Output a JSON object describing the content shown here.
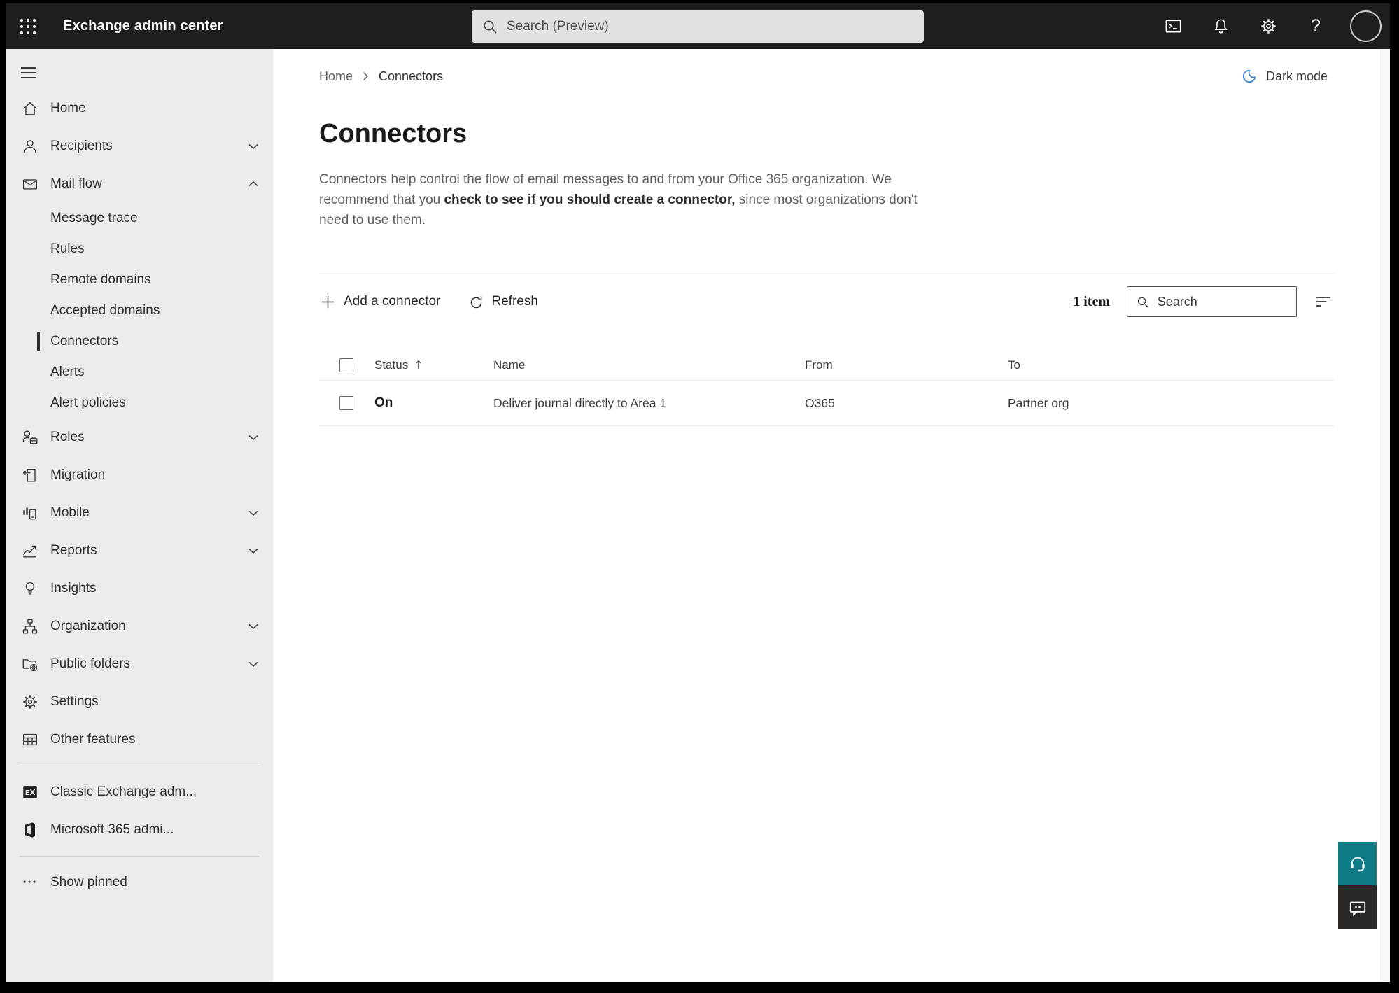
{
  "topbar": {
    "app_title": "Exchange admin center",
    "search_placeholder": "Search (Preview)",
    "icons": [
      "apps-grid-icon",
      "search-icon",
      "terminal-icon",
      "bell-icon",
      "gear-icon",
      "help-icon",
      "avatar"
    ],
    "help_glyph": "?"
  },
  "sidebar": {
    "items": [
      {
        "label": "Home",
        "icon": "home-icon"
      },
      {
        "label": "Recipients",
        "icon": "person-icon",
        "chevron": "down"
      },
      {
        "label": "Mail flow",
        "icon": "mail-icon",
        "chevron": "up",
        "expanded": true
      },
      {
        "label": "Message trace",
        "sub": true
      },
      {
        "label": "Rules",
        "sub": true
      },
      {
        "label": "Remote domains",
        "sub": true
      },
      {
        "label": "Accepted domains",
        "sub": true
      },
      {
        "label": "Connectors",
        "sub": true,
        "selected": true
      },
      {
        "label": "Alerts",
        "sub": true
      },
      {
        "label": "Alert policies",
        "sub": true
      },
      {
        "label": "Roles",
        "icon": "roles-icon",
        "chevron": "down"
      },
      {
        "label": "Migration",
        "icon": "migration-icon"
      },
      {
        "label": "Mobile",
        "icon": "mobile-icon",
        "chevron": "down"
      },
      {
        "label": "Reports",
        "icon": "reports-icon",
        "chevron": "down"
      },
      {
        "label": "Insights",
        "icon": "insights-icon"
      },
      {
        "label": "Organization",
        "icon": "organization-icon",
        "chevron": "down"
      },
      {
        "label": "Public folders",
        "icon": "public-folders-icon",
        "chevron": "down"
      },
      {
        "label": "Settings",
        "icon": "gear-icon"
      },
      {
        "label": "Other features",
        "icon": "table-grid-icon"
      },
      {
        "label": "Classic Exchange adm...",
        "icon": "exchange-logo-icon"
      },
      {
        "label": "Microsoft 365 admi...",
        "icon": "microsoft-365-logo-icon"
      },
      {
        "label": "Show pinned",
        "icon": "ellipsis-icon"
      }
    ]
  },
  "breadcrumb": {
    "home": "Home",
    "current": "Connectors"
  },
  "header": {
    "dark_mode_label": "Dark mode",
    "dark_mode_icon": "moon-icon",
    "accent_blue": "#2b7cd3"
  },
  "page": {
    "title": "Connectors",
    "description_parts": [
      "Connectors help control the flow of email messages to and from your Office 365 organization. We recommend that you ",
      "check to see if you should create a connector,",
      " since most organizations don't need to use them."
    ]
  },
  "toolbar": {
    "add_label": "Add a connector",
    "refresh_label": "Refresh",
    "item_count": "1 item",
    "search_placeholder": "Search",
    "filter_icon": "filter-lines-icon"
  },
  "table": {
    "columns": [
      "Status",
      "Name",
      "From",
      "To"
    ],
    "sort": {
      "column": "Status",
      "direction": "asc",
      "glyph": "↑"
    },
    "rows": [
      {
        "status": "On",
        "name": "Deliver journal directly to Area 1",
        "from": "O365",
        "to": "Partner org"
      }
    ]
  },
  "edge": {
    "help_button_color": "#0e7c86",
    "chat_button_color": "#2b2826",
    "icons": [
      "headset-icon",
      "chat-bubble-icon"
    ]
  },
  "colors": {
    "topbar_bg": "#1f1e1d",
    "sidebar_bg": "#edebe9",
    "selection_bar": "#323130"
  }
}
